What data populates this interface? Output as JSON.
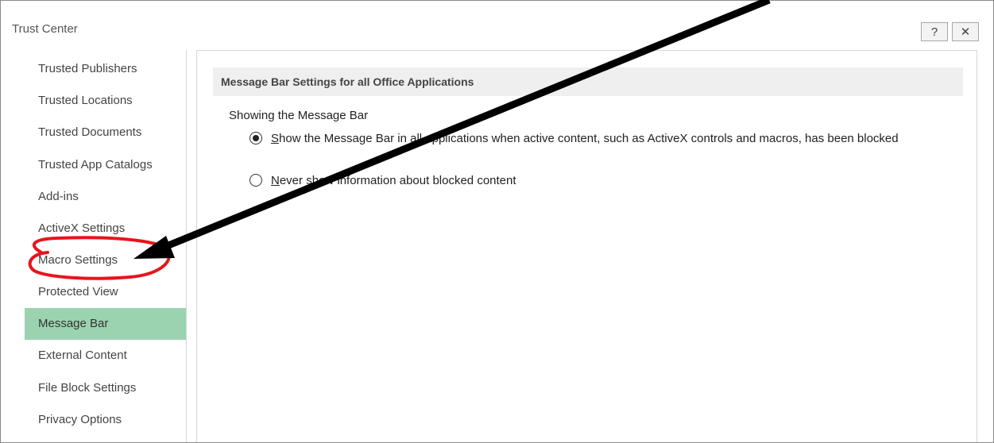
{
  "window": {
    "title": "Trust Center",
    "help_glyph": "?",
    "close_glyph": "✕"
  },
  "sidebar": {
    "items": [
      {
        "label": "Trusted Publishers"
      },
      {
        "label": "Trusted Locations"
      },
      {
        "label": "Trusted Documents"
      },
      {
        "label": "Trusted App Catalogs"
      },
      {
        "label": "Add-ins"
      },
      {
        "label": "ActiveX Settings"
      },
      {
        "label": "Macro Settings"
      },
      {
        "label": "Protected View"
      },
      {
        "label": "Message Bar",
        "selected": true
      },
      {
        "label": "External Content"
      },
      {
        "label": "File Block Settings"
      },
      {
        "label": "Privacy Options"
      }
    ]
  },
  "main": {
    "section_title": "Message Bar Settings for all Office Applications",
    "group_label": "Showing the Message Bar",
    "options": [
      {
        "label": "Show the Message Bar in all applications when active content, such as ActiveX controls and macros, has been blocked",
        "checked": true
      },
      {
        "label": "Never show information about blocked content",
        "checked": false
      }
    ]
  },
  "annotations": {
    "highlight_color": "#e8141c",
    "arrow_color": "#000000"
  },
  "colors": {
    "selected_nav_bg": "#9bd3b0"
  }
}
